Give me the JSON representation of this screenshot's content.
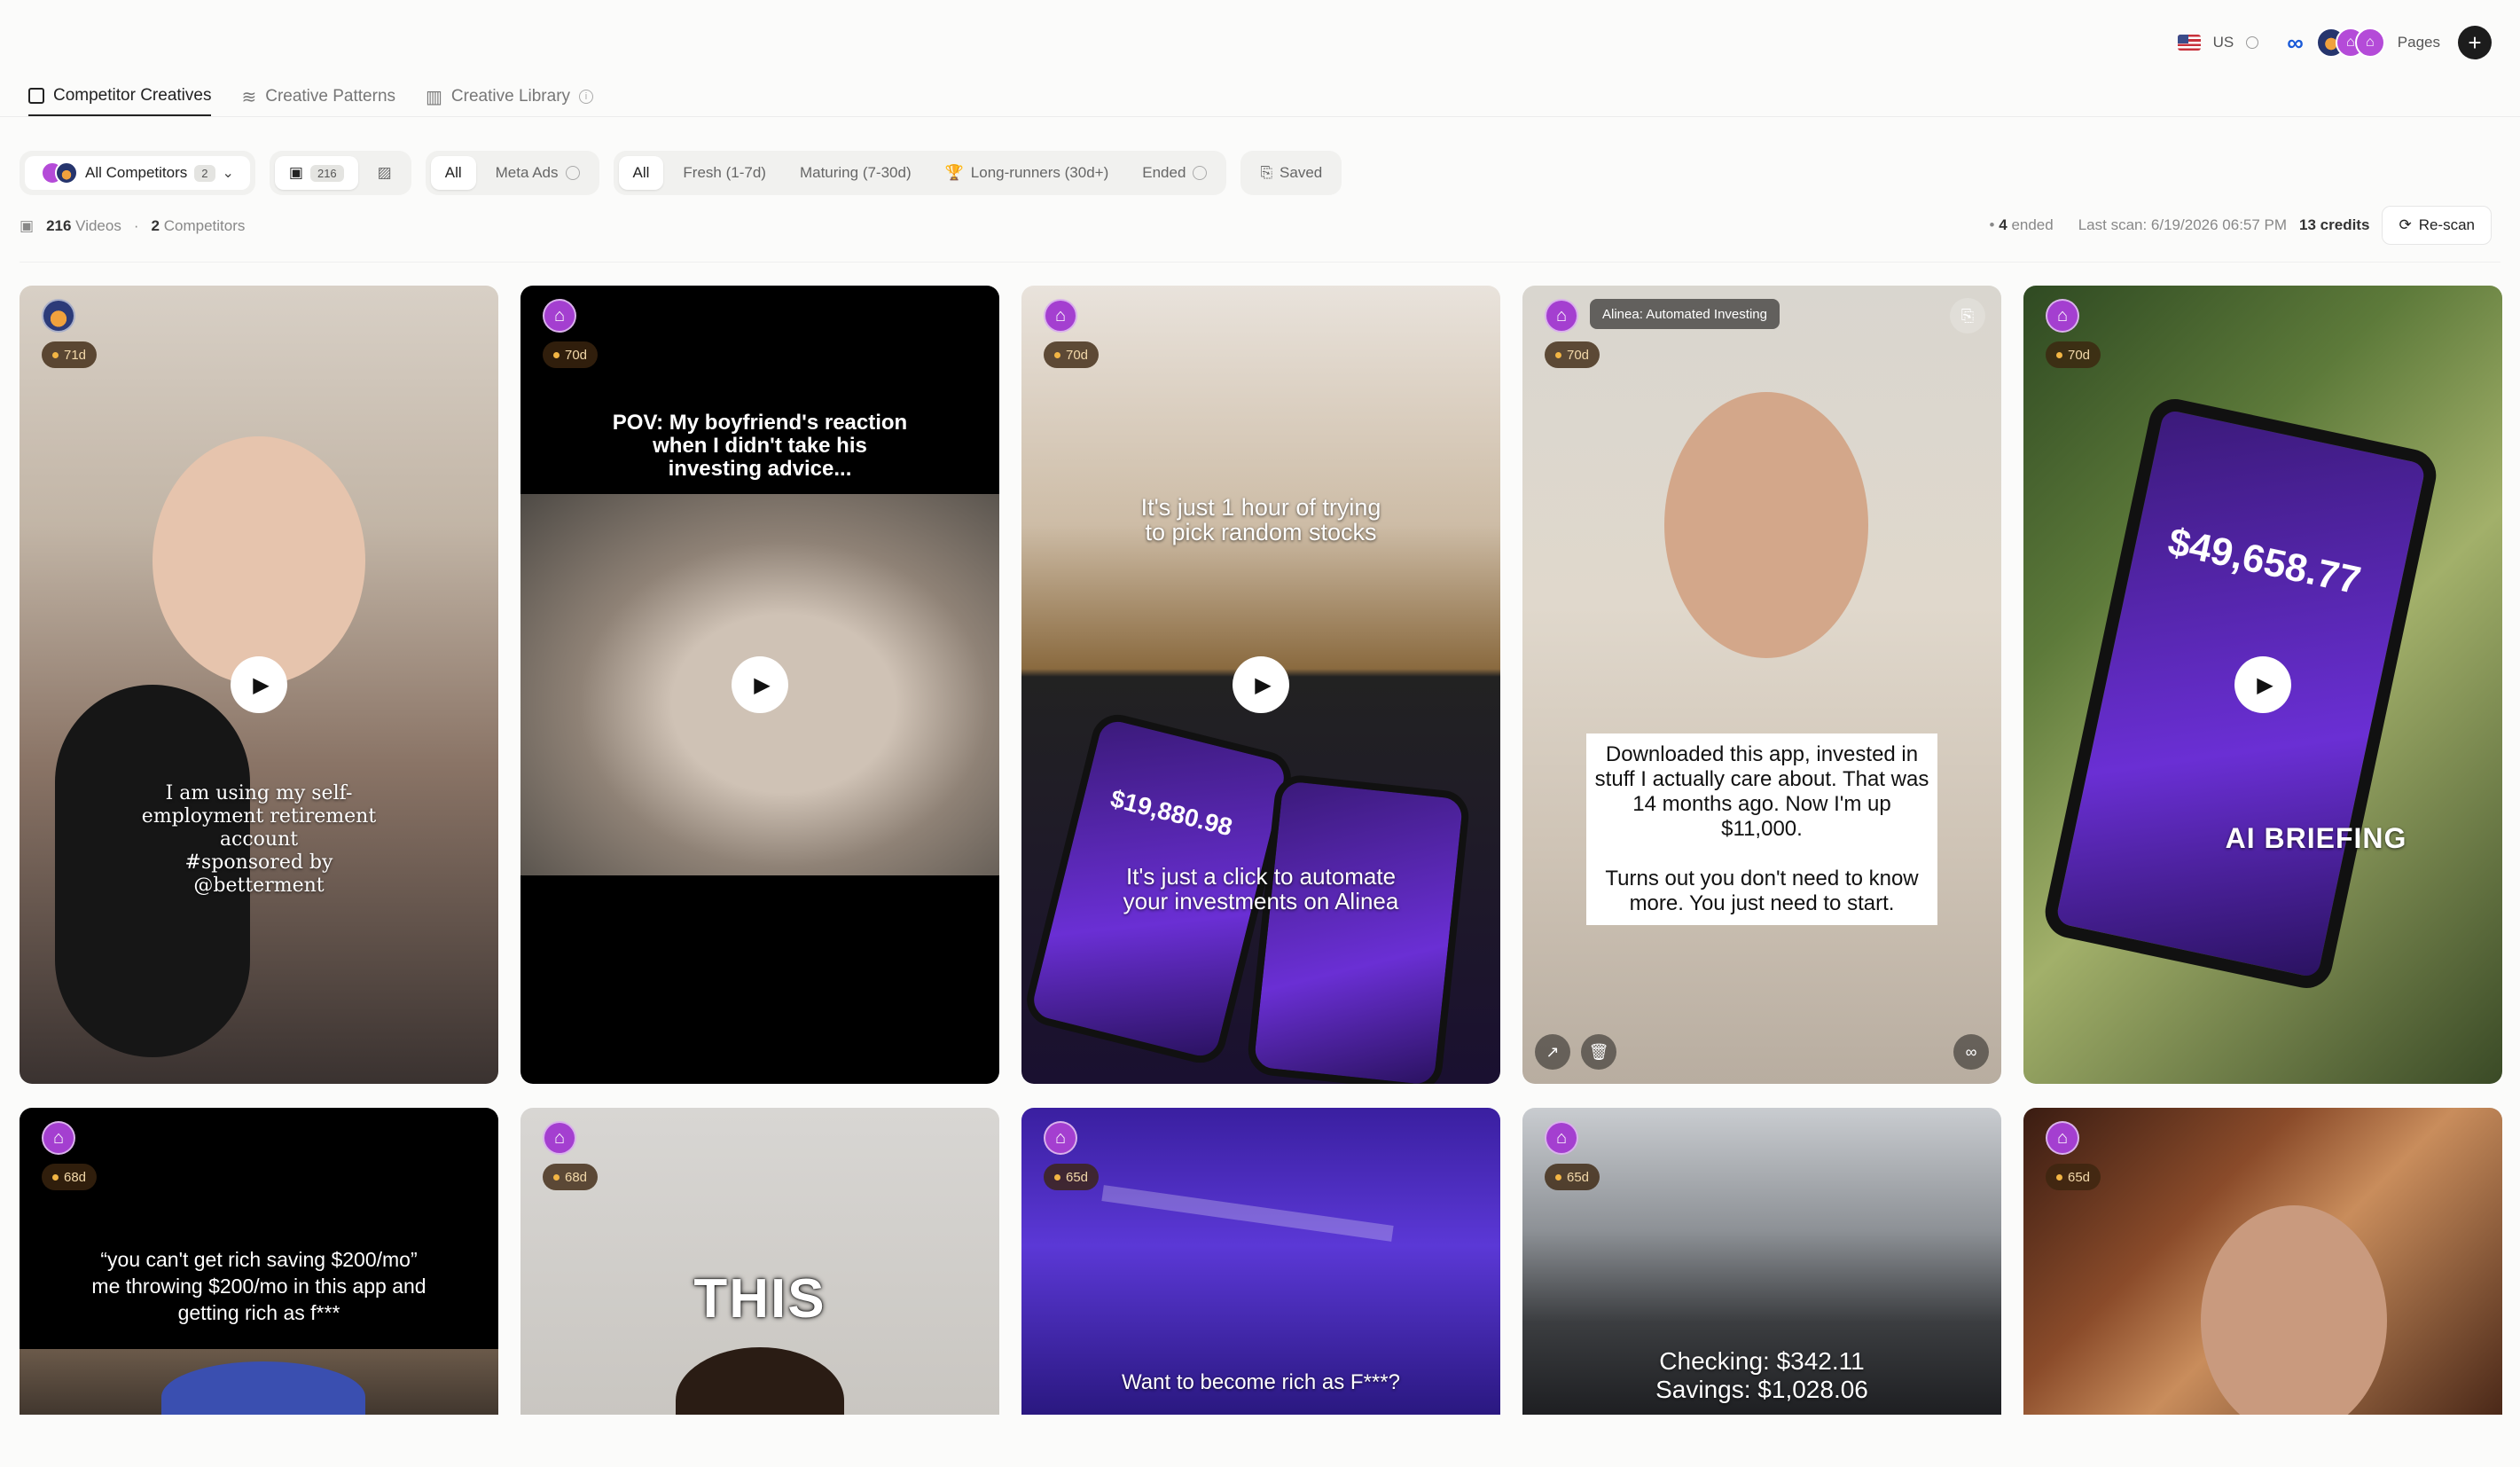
{
  "header": {
    "region": "US",
    "pages_label": "Pages",
    "add_icon": "plus-icon"
  },
  "tabs": [
    {
      "label": "Competitor Creatives",
      "icon": "video-icon",
      "active": true
    },
    {
      "label": "Creative Patterns",
      "icon": "layers-icon",
      "active": false
    },
    {
      "label": "Creative Library",
      "icon": "library-icon",
      "active": false
    }
  ],
  "filters": {
    "competitors_label": "All Competitors",
    "competitors_count": "2",
    "media_count": "216",
    "platform": [
      "All",
      "Meta Ads"
    ],
    "status": [
      "All",
      "Fresh (1-7d)",
      "Maturing (7-30d)",
      "Long-runners (30d+)",
      "Ended"
    ],
    "saved_label": "Saved"
  },
  "stats": {
    "videos_count": "216",
    "videos_label": "Videos",
    "competitors_count": "2",
    "competitors_label": "Competitors",
    "ended_count": "4",
    "ended_label": "ended",
    "last_scan": "Last scan: 6/19/2026 06:57 PM",
    "credits": "13 credits",
    "rescan_label": "Re-scan"
  },
  "cards": [
    {
      "age": "71d",
      "brand": "betterment",
      "caption": "I am using my self-employment retirement account\n#sponsored by @betterment"
    },
    {
      "age": "70d",
      "brand": "alinea",
      "caption": "POV: My boyfriend's reaction when I didn't take his investing advice..."
    },
    {
      "age": "70d",
      "brand": "alinea",
      "caption_top": "It's just 1 hour of trying to pick random stocks",
      "caption_bottom": "It's just a click to automate your investments on Alinea",
      "phone_value": "$19,880.98"
    },
    {
      "age": "70d",
      "brand": "alinea",
      "page_name": "Alinea: Automated Investing",
      "caption": "Downloaded this app, invested in stuff I actually care about. That was 14 months ago. Now I'm up $11,000.\n\nTurns out you don't need to know more. You just need to start."
    },
    {
      "age": "70d",
      "brand": "alinea",
      "phone_value": "$49,658.77",
      "caption": "AI BRIEFING"
    },
    {
      "age": "68d",
      "brand": "alinea",
      "caption": "“you can't get rich saving $200/mo”\nme throwing $200/mo in this app and getting rich as f***"
    },
    {
      "age": "68d",
      "brand": "alinea",
      "caption": "THIS"
    },
    {
      "age": "65d",
      "brand": "alinea",
      "caption": "Want to become rich as F***?"
    },
    {
      "age": "65d",
      "brand": "alinea",
      "caption": "Checking: $342.11\nSavings: $1,028.06"
    },
    {
      "age": "65d",
      "brand": "alinea",
      "caption": ""
    }
  ]
}
